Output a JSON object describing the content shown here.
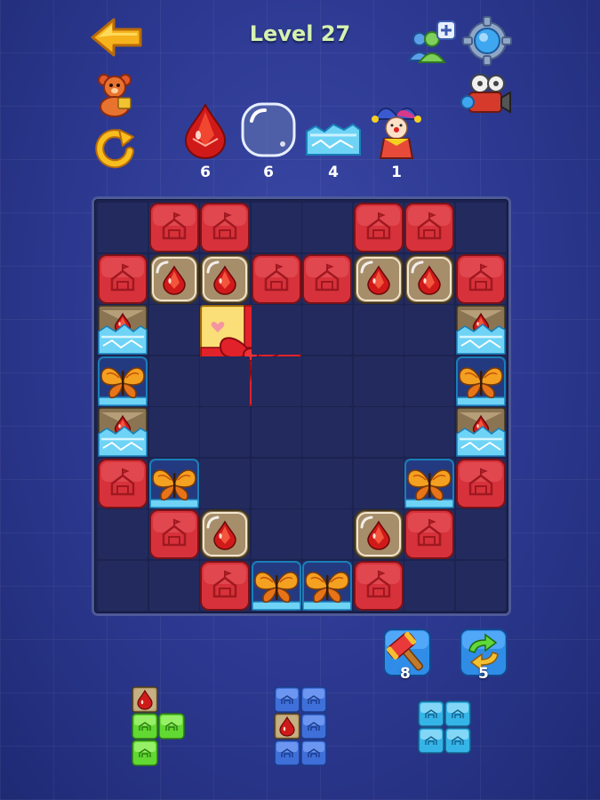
{
  "header": {
    "level_title": "Level 27"
  },
  "goals": [
    {
      "icon": "red-gem-icon",
      "count": "6"
    },
    {
      "icon": "bubble-icon",
      "count": "6"
    },
    {
      "icon": "ice-block-icon",
      "count": "4"
    },
    {
      "icon": "jester-icon",
      "count": "1"
    }
  ],
  "board": {
    "rows": [
      [
        "empty",
        "tent",
        "tent",
        "empty",
        "empty",
        "tent",
        "tent",
        "empty"
      ],
      [
        "tent",
        "gem",
        "gem",
        "tent",
        "tent",
        "gem",
        "gem",
        "tent"
      ],
      [
        "icegem",
        "empty",
        "gift",
        "gift",
        "gift",
        "gift",
        "empty",
        "icegem"
      ],
      [
        "butterfly",
        "empty",
        "gift",
        "gift",
        "gift",
        "gift",
        "empty",
        "butterfly"
      ],
      [
        "icegem",
        "empty",
        "empty",
        "empty",
        "empty",
        "empty",
        "empty",
        "icegem"
      ],
      [
        "tent",
        "butterfly",
        "empty",
        "empty",
        "empty",
        "empty",
        "butterfly",
        "tent"
      ],
      [
        "empty",
        "tent",
        "gem",
        "empty",
        "empty",
        "gem",
        "tent",
        "empty"
      ],
      [
        "empty",
        "empty",
        "tent",
        "butterfly",
        "butterfly",
        "tent",
        "empty",
        "empty"
      ]
    ]
  },
  "boosters": [
    {
      "icon": "hammer-icon",
      "count": "8"
    },
    {
      "icon": "shuffle-icon",
      "count": "5"
    }
  ],
  "colors": {
    "tent_red": "#d7323b",
    "green_block": "#62d832",
    "blue_block": "#3f6fd8",
    "cyan_block": "#35b4e8",
    "title_green": "#d6f1b0"
  }
}
